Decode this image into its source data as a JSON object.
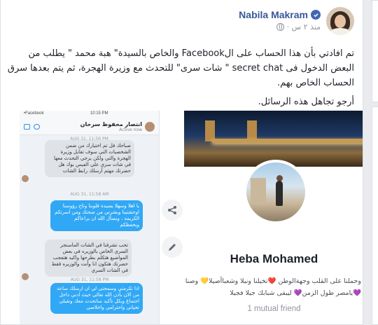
{
  "post": {
    "author": "Nabila Makram",
    "time": "منذ ٢ س ·",
    "paragraph1": "تم افادتي بأن هذا الحساب على الFacebook والخاص بالسيدة\" هبة محمد \" يطلب من البعض الدخول فى secret chat \" شات سرى\" للتحدث مع وزيرة الهجرة، ثم يتم بعدها سرق الحساب الخاص بهم.",
    "paragraph2": "أرجو تجاهل هذه الرسائل."
  },
  "chat_screenshot": {
    "status_left": "•Facebook",
    "status_time": "10:15 PM",
    "contact_name": "انتصار محفوظ سرحان",
    "contact_status": "Active now",
    "date1": "AUG 31, 11:56 PM",
    "msg1": "صباحك فل تم اختيارك من ضمن الشخصيات التي سوف تقابل وزيرة الهجرة والتي ولكن يرجي التحدث معها في شات سري علي الفيس بوك هل حضرتك مهتم أرسلك رابط الشات",
    "date2": "AUG 31, 11:58 AM",
    "msg2": "يا اهلا وسهلا بسيدة قلوبنا وتاج رؤوسنا اوحشتينا وبشرني من صحتك ومن اسرتكم الكريمة ، ونسأل الله ان يراعاكم ويحفظكم",
    "msg3": "تحب تشرفنا في الشات الماسنجر السري الخاص بالوزيره في بعض المواضيع هتكلم بطرحها واكيد هتعجب حضرتك هتكون انا وأنت والوزيره فقط في الشات السري",
    "date3": "AUG 31, 11:58 PM",
    "msg4": "اذا تكرمتي وسمحتي لي ان ارسلك ساعة من الان بأذن الله تعالى حيث ادني داخل اجتماع وبكل تأكيد ساتحدث معك وتقبلي تحياتي واحترامي واخلاصي"
  },
  "profile": {
    "name": "Heba Mohamed",
    "bio_line1": "وحملنا على القلب وجهةالوطن ❤️تخيلنا ونيلا وشعباأصيلا💛 وصنا",
    "bio_line2": "💜يامصر طول الزمن💜 ليبقى شبابك جيلا فجيلا",
    "mutual": "1 mutual friend"
  },
  "colors": {
    "link": "#385898",
    "verified": "#4267b2",
    "messenger_blue": "#31a8f5",
    "meta_gray": "#90949c"
  },
  "icons": [
    "verified-badge-icon",
    "globe-icon",
    "share-icon",
    "edit-icon",
    "video-call-icon",
    "phone-icon"
  ]
}
